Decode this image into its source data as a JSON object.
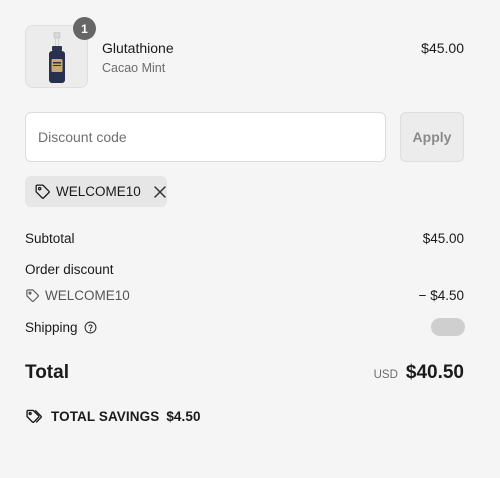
{
  "product": {
    "name": "Glutathione",
    "variant": "Cacao Mint",
    "price": "$45.00",
    "quantity": "1"
  },
  "discount": {
    "placeholder": "Discount code",
    "value": "",
    "apply_label": "Apply",
    "applied_code": "WELCOME10"
  },
  "summary": {
    "subtotal_label": "Subtotal",
    "subtotal_value": "$45.00",
    "order_discount_label": "Order discount",
    "order_discount_code": "WELCOME10",
    "order_discount_value": "− $4.50",
    "shipping_label": "Shipping",
    "total_label": "Total",
    "currency": "USD",
    "total_value": "$40.50",
    "savings_label": "TOTAL SAVINGS",
    "savings_value": "$4.50"
  },
  "icons": {
    "tag": "tag-icon",
    "close": "close-icon",
    "help": "question-circle-icon",
    "savings": "double-tag-icon"
  },
  "colors": {
    "background": "#f5f5f5",
    "badge": "#666666",
    "skeleton": "#cfcfcf"
  }
}
